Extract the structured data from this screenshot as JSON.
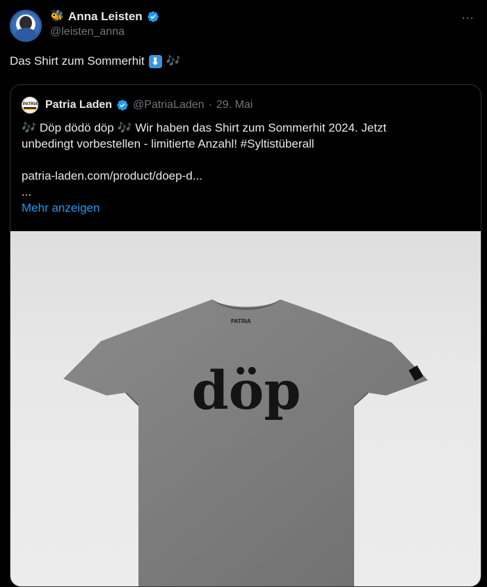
{
  "author": {
    "display_name": "Anna Leisten",
    "handle": "@leisten_anna",
    "avatar_icon": "profile-avatar",
    "badge_icon": "bee-emoji",
    "verified": true
  },
  "tweet": {
    "text": "Das Shirt zum Sommerhit",
    "emoji_down": "⬇",
    "emoji_notes": "🎶"
  },
  "quoted": {
    "display_name": "Patria Laden",
    "handle": "@PatriaLaden",
    "separator": "·",
    "date": "29. Mai",
    "line1_notes": "🎶",
    "line1": "Döp dödö döp",
    "line1_rest": "Wir haben das Shirt zum Sommerhit 2024. Jetzt",
    "line2": "unbedingt vorbestellen - limitierte Anzahl! #Syltistüberall",
    "link": "patria-laden.com/product/doep-d...",
    "ellipsis": "...",
    "show_more": "Mehr anzeigen",
    "avatar_label": "PATRIA"
  },
  "media": {
    "shirt_print": "döp",
    "shirt_label": "PATRIA",
    "shirt_color": "#7d7d7d",
    "print_color": "#141414"
  },
  "colors": {
    "background": "#000000",
    "text": "#e7e9ea",
    "muted": "#71767b",
    "accent": "#1d9bf0",
    "border": "#2f3336"
  }
}
